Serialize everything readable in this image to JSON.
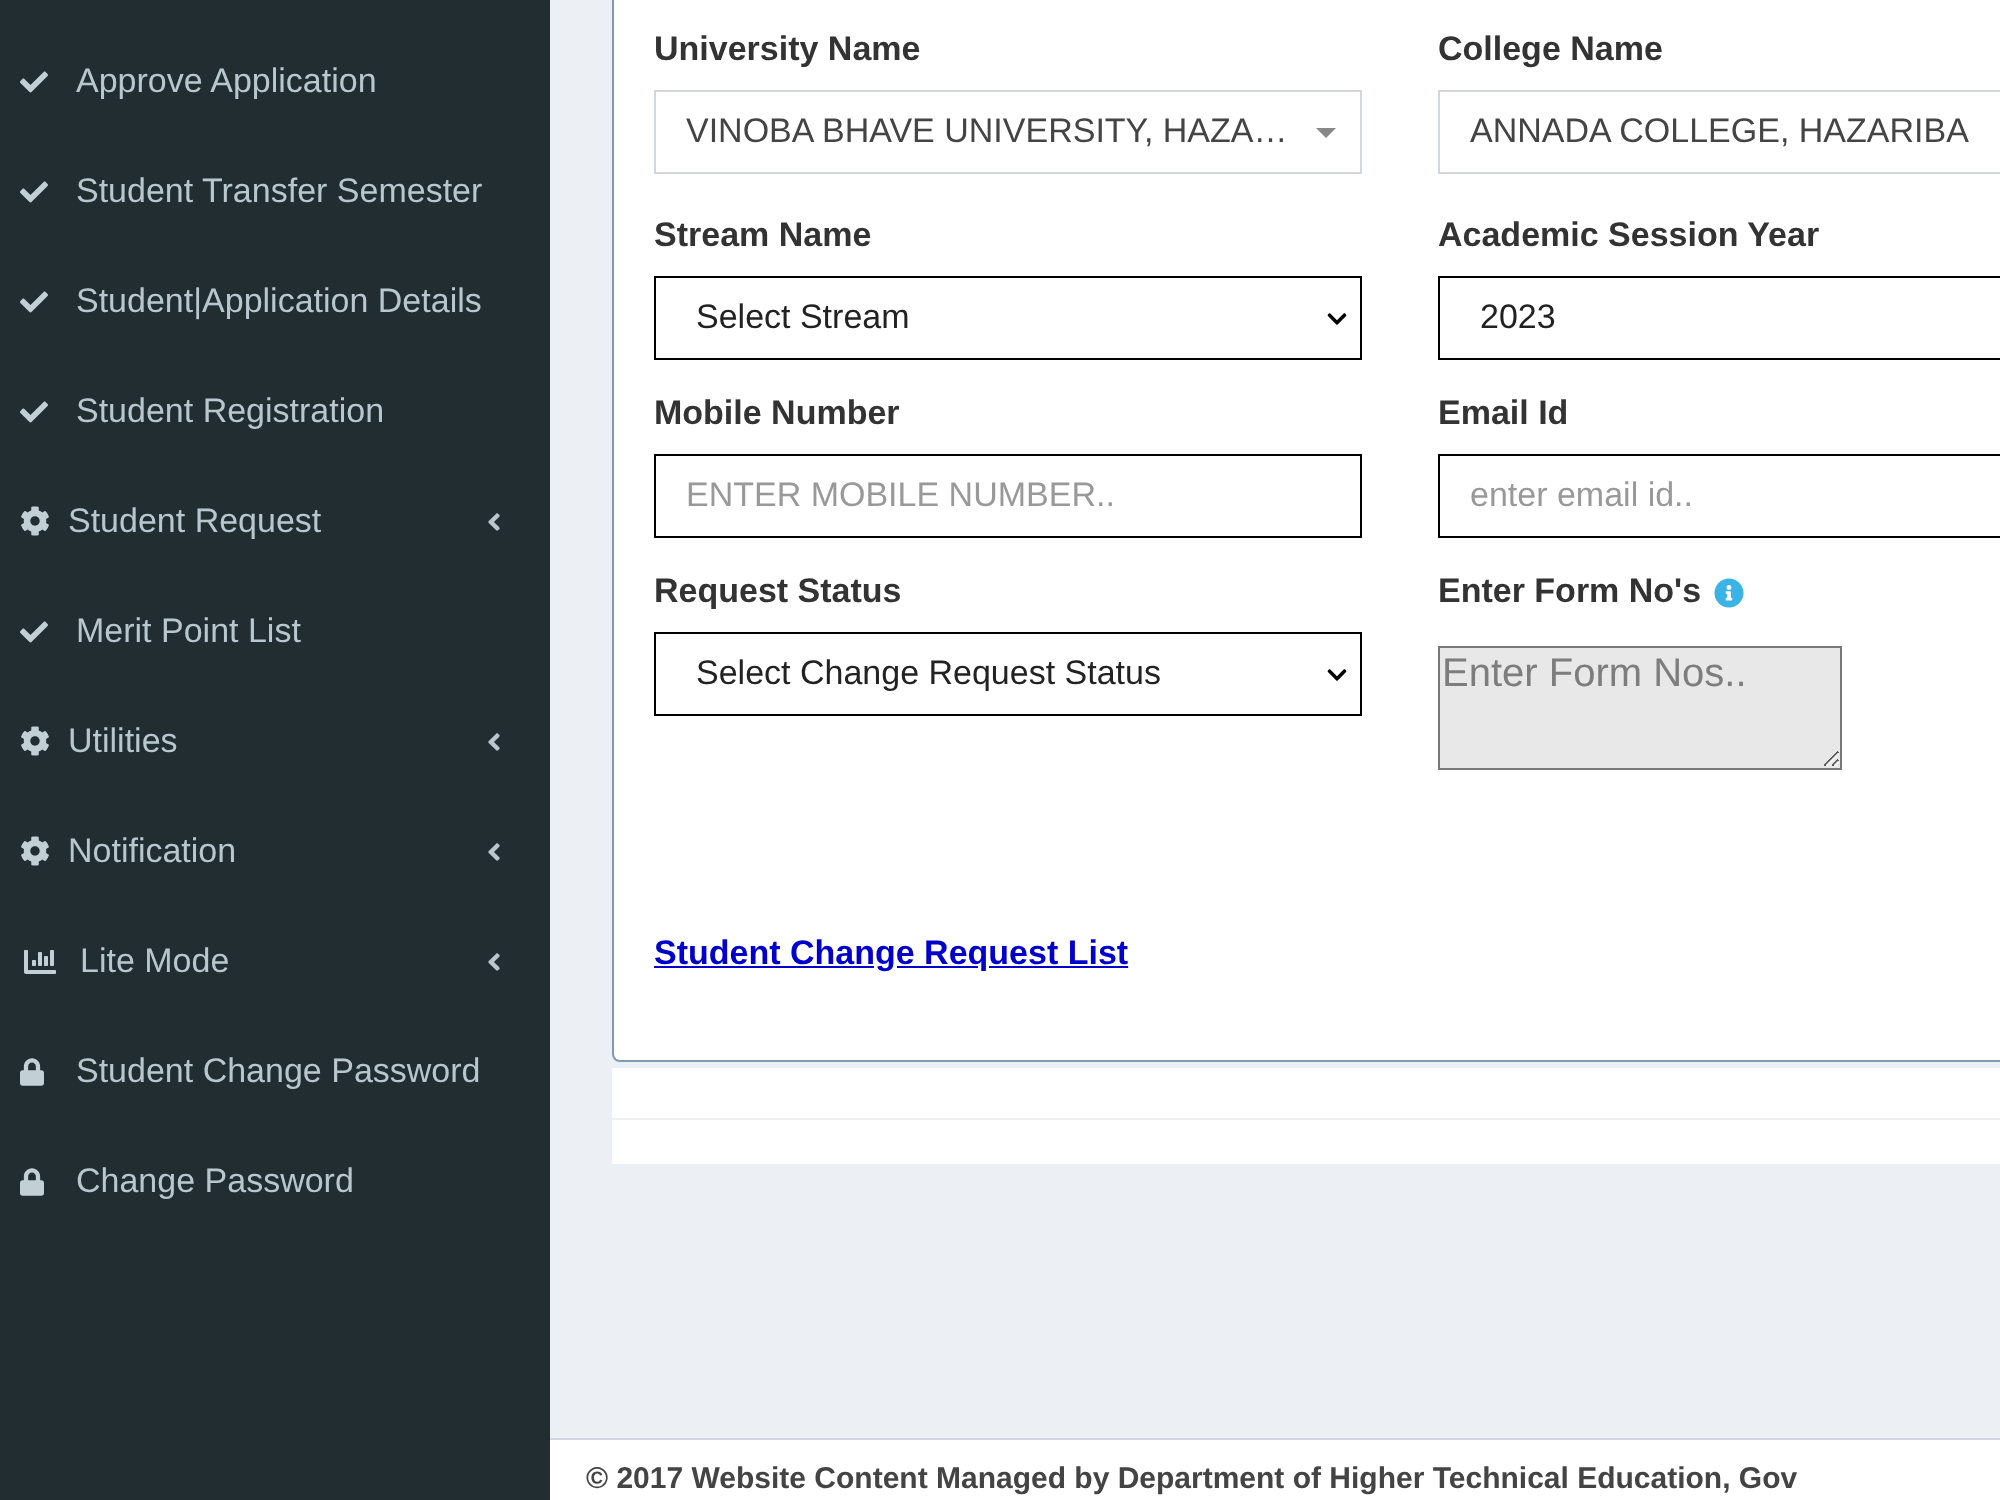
{
  "sidebar": {
    "items": [
      {
        "label": "Approve Application",
        "kind": "check",
        "submenu": false
      },
      {
        "label": "Student Transfer Semester",
        "kind": "check",
        "submenu": false
      },
      {
        "label": "Student|Application Details",
        "kind": "check",
        "submenu": false
      },
      {
        "label": "Student Registration",
        "kind": "check",
        "submenu": false
      },
      {
        "label": "Student Request",
        "kind": "gear",
        "submenu": true
      },
      {
        "label": "Merit Point List",
        "kind": "check",
        "submenu": false
      },
      {
        "label": "Utilities",
        "kind": "gear",
        "submenu": true
      },
      {
        "label": "Notification",
        "kind": "gear",
        "submenu": true
      },
      {
        "label": "Lite Mode",
        "kind": "chart",
        "submenu": true
      },
      {
        "label": "Student Change Password",
        "kind": "lock",
        "submenu": false
      },
      {
        "label": "Change Password",
        "kind": "lock",
        "submenu": false
      }
    ]
  },
  "form": {
    "fields": [
      {
        "label": "University Name",
        "kind": "select2",
        "value": "VINOBA BHAVE UNIVERSITY, HAZA…",
        "arrow": true,
        "disabled": false
      },
      {
        "label": "College Name",
        "kind": "select2",
        "value": "ANNADA COLLEGE, HAZARIBA",
        "arrow": false,
        "disabled": false
      },
      {
        "label": "Stream Name",
        "kind": "select",
        "value": "Select Stream",
        "arrow": true,
        "disabled": false
      },
      {
        "label": "Academic Session Year",
        "kind": "select",
        "value": "2023",
        "arrow": false,
        "disabled": false
      },
      {
        "label": "Mobile Number",
        "kind": "input",
        "placeholder": "ENTER MOBILE NUMBER..",
        "disabled": false
      },
      {
        "label": "Email Id",
        "kind": "input",
        "placeholder": "enter email id..",
        "disabled": false
      },
      {
        "label": "Request Status",
        "kind": "select",
        "value": "Select Change Request Status",
        "arrow": true,
        "disabled": false
      },
      {
        "label": "Enter Form No's",
        "kind": "textarea",
        "placeholder": "Enter Form Nos..",
        "disabled": true,
        "info": true
      }
    ],
    "link": "Student Change Request List"
  },
  "footer": {
    "text": "© 2017 Website Content Managed by Department of Higher Technical Education, Gov"
  }
}
